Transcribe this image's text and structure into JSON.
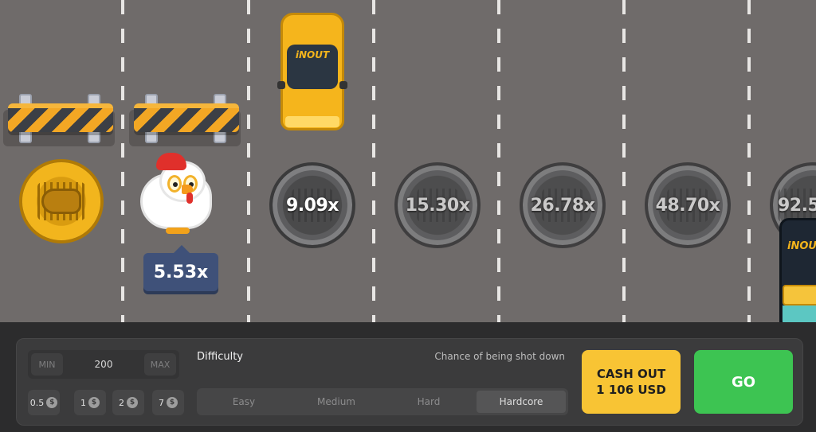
{
  "game": {
    "current_multiplier": "5.53x",
    "lane_multipliers": [
      "9.09x",
      "15.30x",
      "26.78x",
      "48.70x",
      "92.5"
    ],
    "car_logo": "iNOUT"
  },
  "controls": {
    "bet": {
      "min_label": "MIN",
      "value": "200",
      "max_label": "MAX"
    },
    "chips": [
      {
        "label": "0.5",
        "icon": "$"
      },
      {
        "label": "1",
        "icon": "$"
      },
      {
        "label": "2",
        "icon": "$"
      },
      {
        "label": "7",
        "icon": "$"
      }
    ],
    "difficulty_label": "Difficulty",
    "chance_label": "Chance of being shot down",
    "difficulty_options": [
      "Easy",
      "Medium",
      "Hard",
      "Hardcore"
    ],
    "difficulty_selected": "Hardcore",
    "cashout": {
      "line1": "CASH OUT",
      "line2": "1 106 USD"
    },
    "go_label": "GO"
  },
  "colors": {
    "road": "#6f6b6a",
    "bar_bg": "#2c2c2d",
    "cashout": "#f8c434",
    "go": "#3dc452",
    "tag": "#3f5179"
  }
}
